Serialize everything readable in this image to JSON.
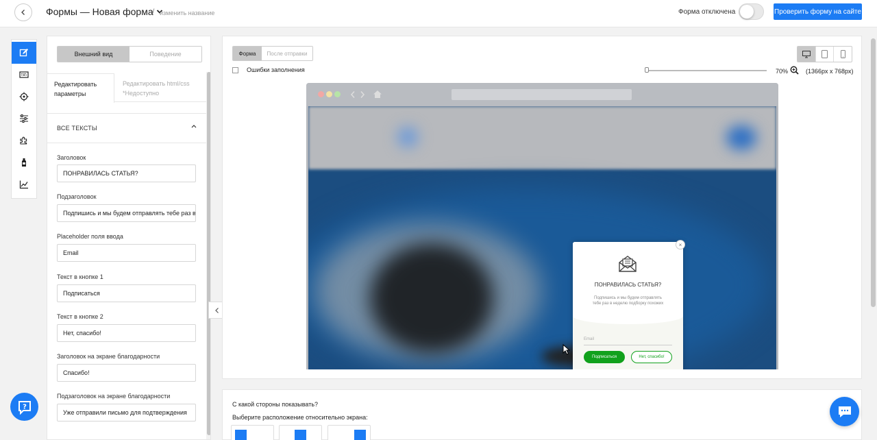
{
  "header": {
    "title": "Формы — Новая форма",
    "separator": "/",
    "rename_link": "изменить название",
    "toggle_label": "Форма отключена",
    "toggle_on": false,
    "check_button": "Проверить форму на сайте"
  },
  "toolbar_icons": [
    "edit-icon",
    "keyboard-icon",
    "target-icon",
    "sliders-icon",
    "puzzle-icon",
    "bottle-icon",
    "chart-icon"
  ],
  "left_panel": {
    "segments": [
      "Внешний вид",
      "Поведение"
    ],
    "tab_params": "Редактировать параметры",
    "tab_html": "Редактировать html/css *Недоступно",
    "section_title": "ВСЕ ТЕКСТЫ",
    "fields": [
      {
        "label": "Заголовок",
        "value": "ПОНРАВИЛАСЬ СТАТЬЯ?"
      },
      {
        "label": "Подзаголовок",
        "value": "Подпишись и мы будем отправлять тебе раз в"
      },
      {
        "label": "Placeholder поля ввода",
        "value": "Email"
      },
      {
        "label": "Текст в кнопке 1",
        "value": "Подписаться"
      },
      {
        "label": "Текст в кнопке 2",
        "value": "Нет, спасибо!"
      },
      {
        "label": "Заголовок на экране благодарности",
        "value": "Спасибо!"
      },
      {
        "label": "Подзаголовок на экране благодарности",
        "value": "Уже отправили письмо для подтверждения"
      }
    ]
  },
  "preview": {
    "tabs": [
      "Форма",
      "После отправки"
    ],
    "errors_checkbox": "Ошибки заполнения",
    "zoom": "70%",
    "resolution": "(1366px x 768px)",
    "popup": {
      "title": "ПОНРАВИЛАСЬ СТАТЬЯ?",
      "subtitle": "Подпишись и мы будем отправлять тебе раз в неделю подборку похожих",
      "email_placeholder": "Email",
      "button1": "Подписаться",
      "button2": "Нет, спасибо!",
      "close": "×"
    }
  },
  "position": {
    "question": "С какой стороны показывать?",
    "hint": "Выберите расположение относительно экрана:"
  },
  "colors": {
    "accent": "#1c7cf4",
    "green": "#11a11c"
  }
}
